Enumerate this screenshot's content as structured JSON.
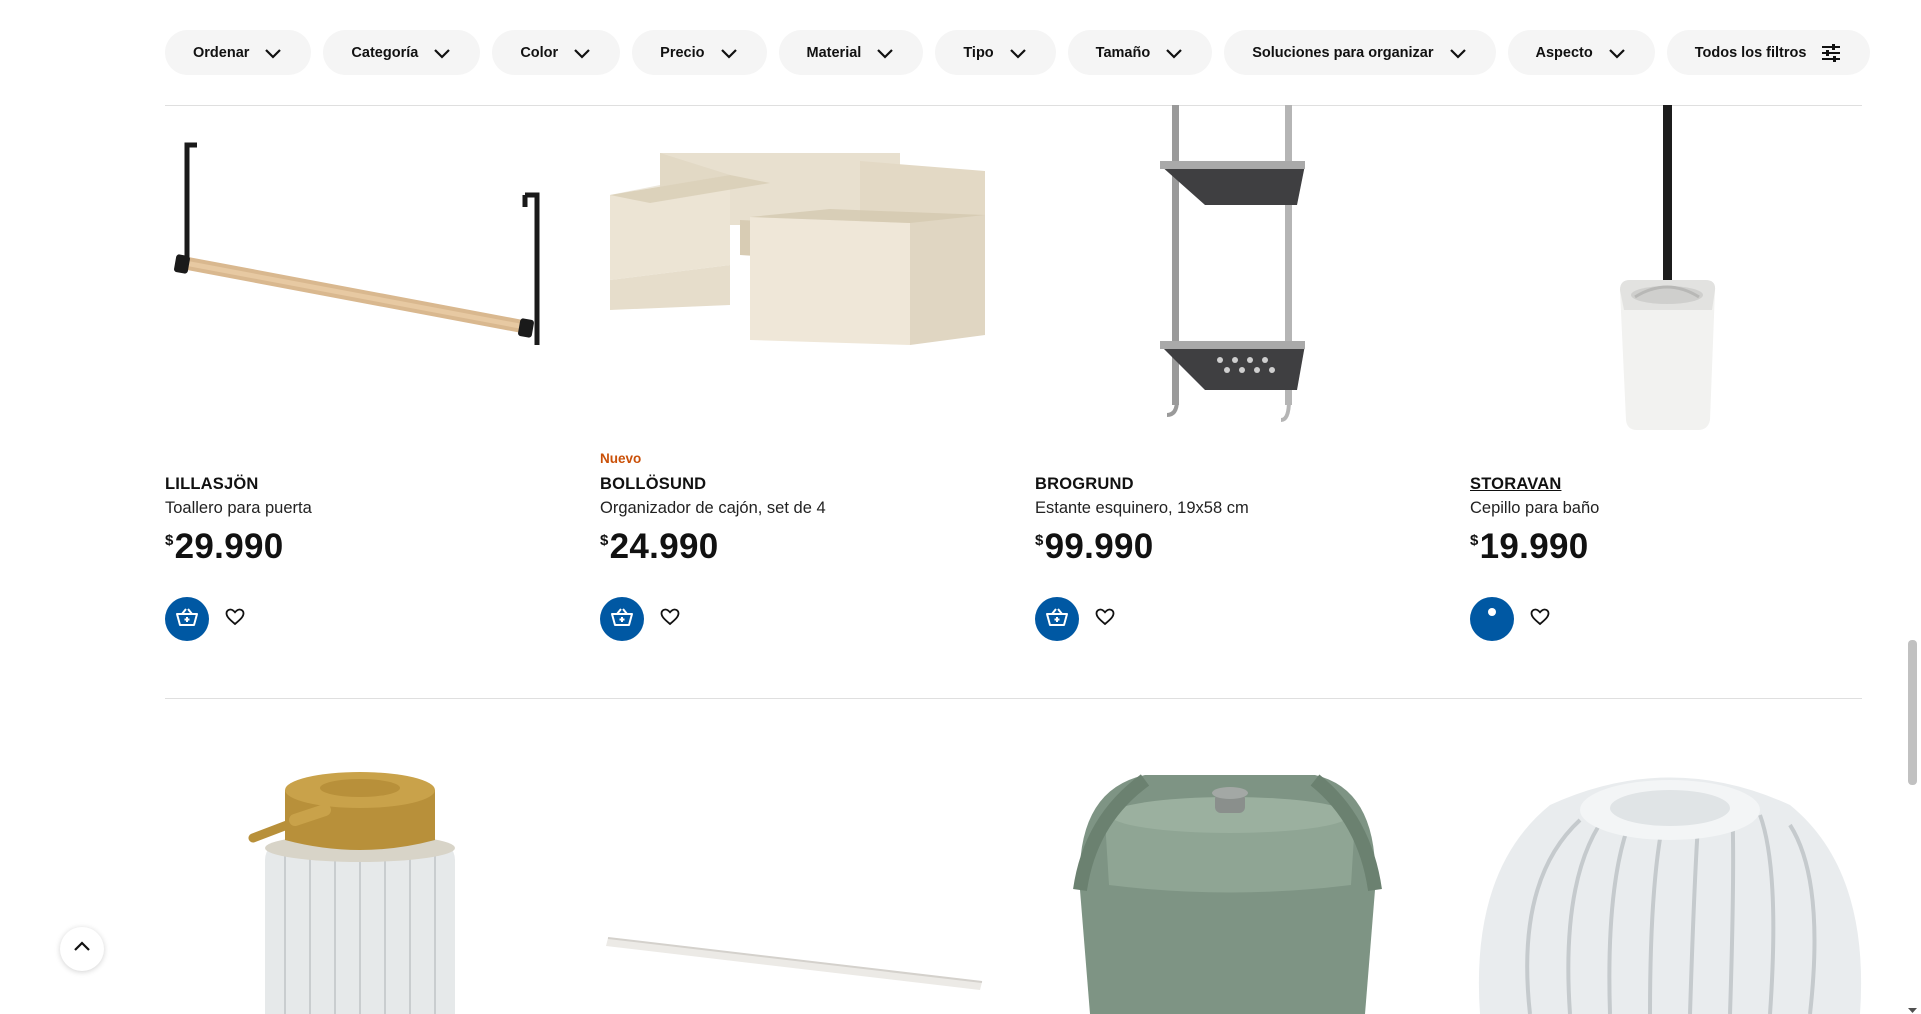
{
  "filters": [
    {
      "label": "Ordenar",
      "icon": "chevron-down-icon"
    },
    {
      "label": "Categoría",
      "icon": "chevron-down-icon"
    },
    {
      "label": "Color",
      "icon": "chevron-down-icon"
    },
    {
      "label": "Precio",
      "icon": "chevron-down-icon"
    },
    {
      "label": "Material",
      "icon": "chevron-down-icon"
    },
    {
      "label": "Tipo",
      "icon": "chevron-down-icon"
    },
    {
      "label": "Tamaño",
      "icon": "chevron-down-icon"
    },
    {
      "label": "Soluciones para organizar",
      "icon": "chevron-down-icon"
    },
    {
      "label": "Aspecto",
      "icon": "chevron-down-icon"
    },
    {
      "label": "Todos los filtros",
      "icon": "sliders-icon"
    }
  ],
  "products": [
    {
      "badge": "",
      "name": "LILLASJÖN",
      "description": "Toallero para puerta",
      "currency": "$",
      "price": "29.990",
      "image": "towel-rail-image"
    },
    {
      "badge": "Nuevo",
      "name": "BOLLÖSUND",
      "description": "Organizador de cajón, set de 4",
      "currency": "$",
      "price": "24.990",
      "image": "drawer-organizer-image"
    },
    {
      "badge": "",
      "name": "BROGRUND",
      "description": "Estante esquinero, 19x58 cm",
      "currency": "$",
      "price": "99.990",
      "image": "corner-shelf-image"
    },
    {
      "badge": "",
      "name": "STORAVAN",
      "description": "Cepillo para baño",
      "currency": "$",
      "price": "19.990",
      "image": "toilet-brush-image"
    }
  ],
  "next_row_images": [
    "soap-dispenser-image",
    "wall-rail-image",
    "green-bin-image",
    "glass-jar-image"
  ],
  "colors": {
    "accent": "#0058a3",
    "badge": "#ca5008",
    "pill_bg": "#f5f5f5"
  }
}
